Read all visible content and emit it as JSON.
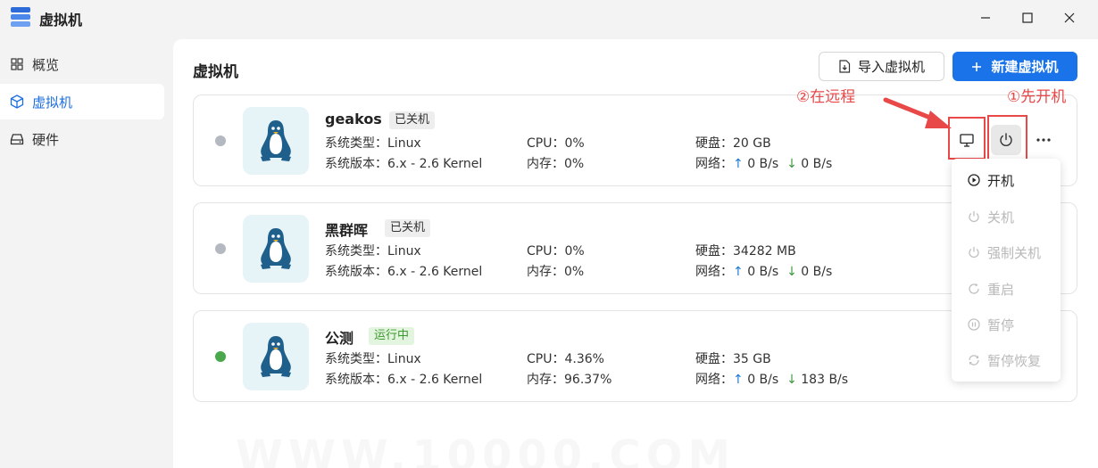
{
  "window": {
    "title": "虚拟机",
    "icon": "server-stack-icon"
  },
  "sidebar": {
    "items": [
      {
        "label": "概览",
        "icon": "grid-icon"
      },
      {
        "label": "虚拟机",
        "icon": "cube-icon",
        "active": true
      },
      {
        "label": "硬件",
        "icon": "hard-drive-icon"
      }
    ]
  },
  "main": {
    "title": "虚拟机",
    "import_label": "导入虚拟机",
    "new_label": "新建虚拟机"
  },
  "labels": {
    "os_type": "系统类型：",
    "os_version": "系统版本：",
    "cpu": "CPU：",
    "memory": "内存：",
    "disk": "硬盘：",
    "network": "网络：",
    "up_arrow": "↑",
    "down_arrow": "↓"
  },
  "vms": [
    {
      "name": "geakos",
      "status": "已关机",
      "status_color": "#b4b8c0",
      "os_type": "Linux",
      "os_version": "6.x - 2.6 Kernel",
      "cpu": "0%",
      "memory": "0%",
      "disk": "20 GB",
      "net_up": "0 B/s",
      "net_down": "0 B/s"
    },
    {
      "name": "黑群晖",
      "status": "已关机",
      "status_color": "#b4b8c0",
      "os_type": "Linux",
      "os_version": "6.x - 2.6 Kernel",
      "cpu": "0%",
      "memory": "0%",
      "disk": "34282 MB",
      "net_up": "0 B/s",
      "net_down": "0 B/s"
    },
    {
      "name": "公测",
      "status": "运行中",
      "status_color": "#4aa84a",
      "os_type": "Linux",
      "os_version": "6.x - 2.6 Kernel",
      "cpu": "4.36%",
      "memory": "96.37%",
      "disk": "35 GB",
      "net_up": "0 B/s",
      "net_down": "183 B/s"
    }
  ],
  "menu": {
    "items": [
      {
        "label": "开机",
        "icon": "play-circle-icon",
        "enabled": true
      },
      {
        "label": "关机",
        "icon": "power-icon",
        "enabled": false
      },
      {
        "label": "强制关机",
        "icon": "power-icon",
        "enabled": false
      },
      {
        "label": "重启",
        "icon": "restart-icon",
        "enabled": false
      },
      {
        "label": "暂停",
        "icon": "pause-circle-icon",
        "enabled": false
      },
      {
        "label": "暂停恢复",
        "icon": "resume-icon",
        "enabled": false
      }
    ]
  },
  "annotations": {
    "step1": "①先开机",
    "step2": "②在远程"
  },
  "colors": {
    "accent": "#1a73e8",
    "annotation": "#e84848",
    "stopped": "#b4b8c0",
    "running": "#4aa84a"
  }
}
